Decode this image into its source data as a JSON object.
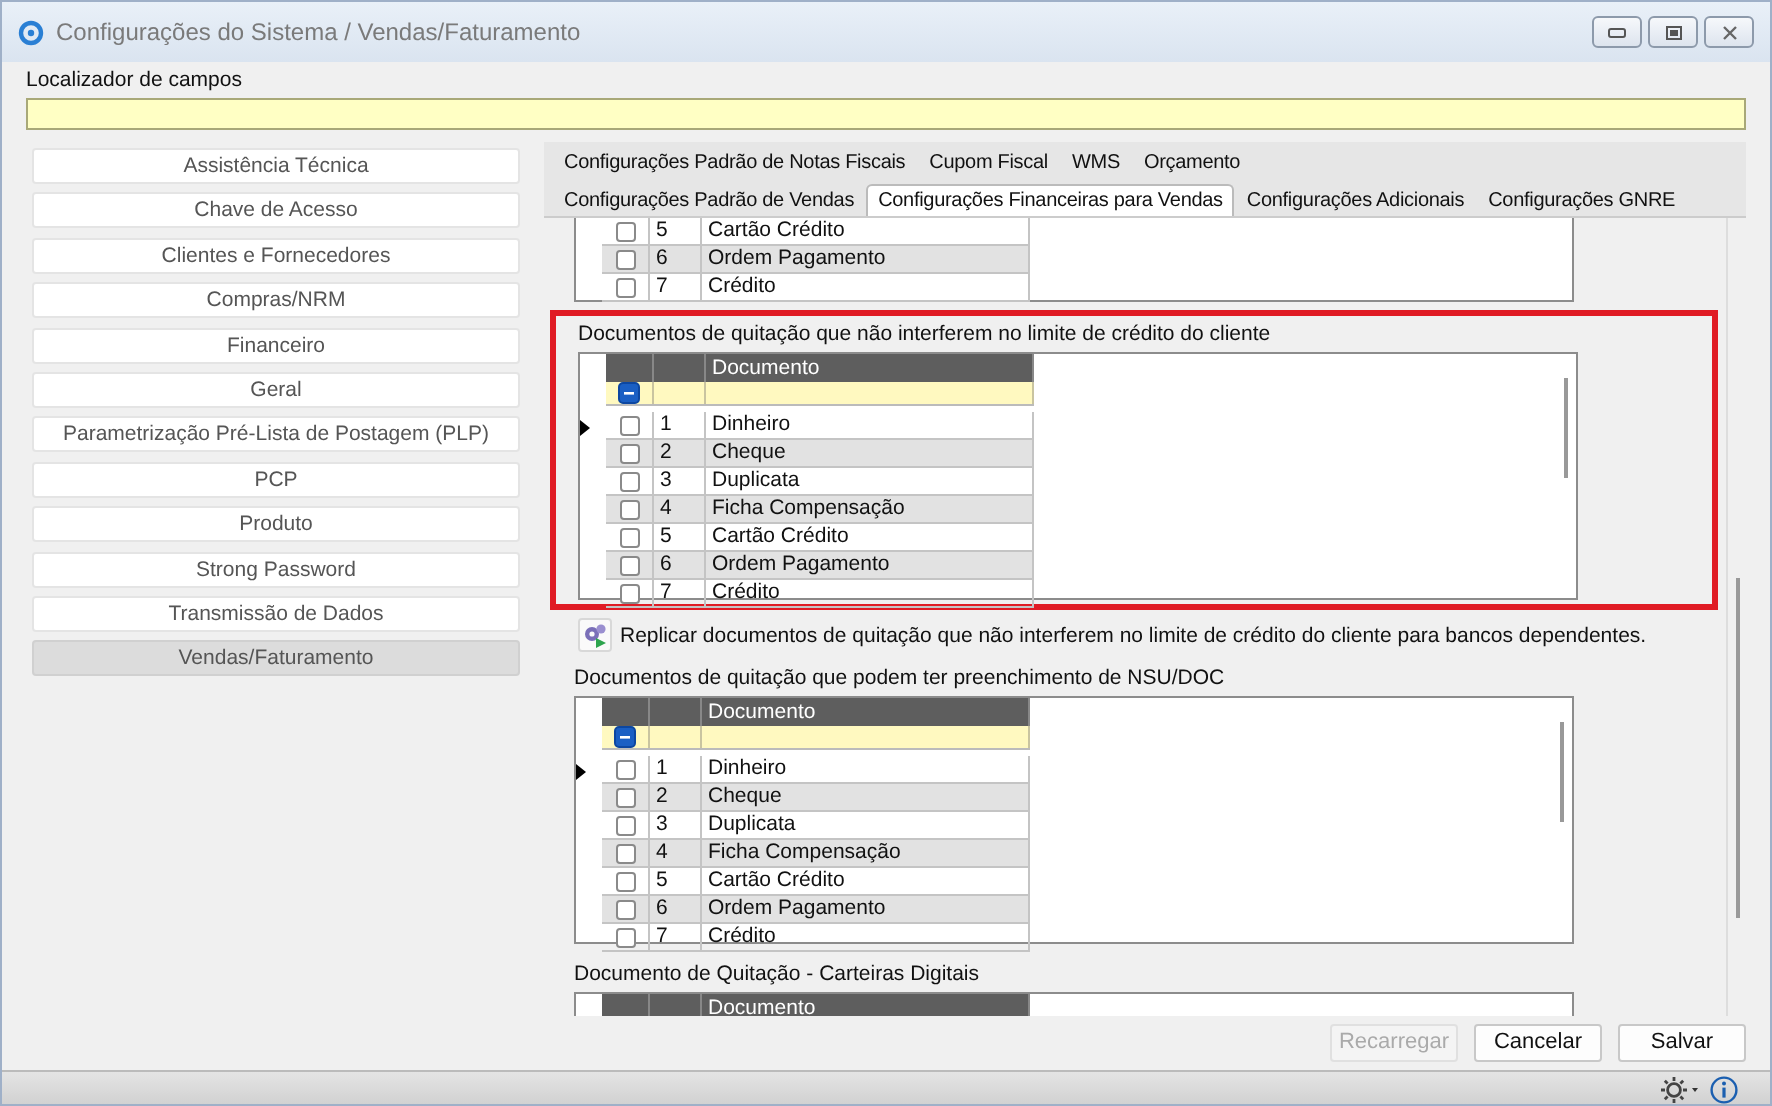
{
  "window": {
    "title": "Configurações do Sistema / Vendas/Faturamento"
  },
  "locator": {
    "label": "Localizador de campos"
  },
  "sidebar": {
    "items": [
      {
        "label": "Assistência Técnica",
        "selected": false
      },
      {
        "label": "Chave de Acesso",
        "selected": false
      },
      {
        "label": "Clientes e Fornecedores",
        "selected": false
      },
      {
        "label": "Compras/NRM",
        "selected": false
      },
      {
        "label": "Financeiro",
        "selected": false
      },
      {
        "label": "Geral",
        "selected": false
      },
      {
        "label": "Parametrização Pré-Lista de Postagem (PLP)",
        "selected": false
      },
      {
        "label": "PCP",
        "selected": false
      },
      {
        "label": "Produto",
        "selected": false
      },
      {
        "label": "Strong Password",
        "selected": false
      },
      {
        "label": "Transmissão de Dados",
        "selected": false
      },
      {
        "label": "Vendas/Faturamento",
        "selected": true
      }
    ]
  },
  "tabs": {
    "upper_row": [
      {
        "label": "Configurações Padrão de Notas Fiscais",
        "selected": false
      },
      {
        "label": "Cupom Fiscal",
        "selected": false
      },
      {
        "label": "WMS",
        "selected": false
      },
      {
        "label": "Orçamento",
        "selected": false
      }
    ],
    "lower_row": [
      {
        "label": "Configurações Padrão de Vendas",
        "selected": false
      },
      {
        "label": "Configurações Financeiras para Vendas",
        "selected": true
      },
      {
        "label": "Configurações Adicionais",
        "selected": false
      },
      {
        "label": "Configurações GNRE",
        "selected": false
      }
    ]
  },
  "content": [
    {
      "kind": "grid",
      "rows": [
        {
          "number": "5",
          "document": "Cartão Crédito",
          "checked": false,
          "current": false
        },
        {
          "number": "6",
          "document": "Ordem Pagamento",
          "checked": false,
          "current": false
        },
        {
          "number": "7",
          "document": "Crédito",
          "checked": false,
          "current": false
        }
      ]
    },
    {
      "kind": "grid",
      "title": "Documentos de quitação que não interferem no limite de crédito do cliente",
      "highlighted": true,
      "columns": [
        "",
        "",
        "Documento"
      ],
      "select_all_indeterminate": true,
      "rows": [
        {
          "number": "1",
          "document": "Dinheiro",
          "checked": false,
          "current": true
        },
        {
          "number": "2",
          "document": "Cheque",
          "checked": false,
          "current": false
        },
        {
          "number": "3",
          "document": "Duplicata",
          "checked": false,
          "current": false
        },
        {
          "number": "4",
          "document": "Ficha Compensação",
          "checked": false,
          "current": false
        },
        {
          "number": "5",
          "document": "Cartão Crédito",
          "checked": false,
          "current": false
        },
        {
          "number": "6",
          "document": "Ordem Pagamento",
          "checked": false,
          "current": false
        },
        {
          "number": "7",
          "document": "Crédito",
          "checked": false,
          "current": false
        }
      ]
    },
    {
      "kind": "action",
      "label": "Replicar documentos de quitação que não interferem no limite de crédito do cliente para bancos dependentes."
    },
    {
      "kind": "grid",
      "title": "Documentos de quitação que podem ter preenchimento de NSU/DOC",
      "highlighted": false,
      "columns": [
        "",
        "",
        "Documento"
      ],
      "select_all_indeterminate": true,
      "rows": [
        {
          "number": "1",
          "document": "Dinheiro",
          "checked": false,
          "current": true
        },
        {
          "number": "2",
          "document": "Cheque",
          "checked": false,
          "current": false
        },
        {
          "number": "3",
          "document": "Duplicata",
          "checked": false,
          "current": false
        },
        {
          "number": "4",
          "document": "Ficha Compensação",
          "checked": false,
          "current": false
        },
        {
          "number": "5",
          "document": "Cartão Crédito",
          "checked": false,
          "current": false
        },
        {
          "number": "6",
          "document": "Ordem Pagamento",
          "checked": false,
          "current": false
        },
        {
          "number": "7",
          "document": "Crédito",
          "checked": false,
          "current": false
        }
      ]
    },
    {
      "kind": "grid",
      "title": "Documento de Quitação - Carteiras Digitais",
      "highlighted": false,
      "columns": [
        "",
        "",
        "Documento"
      ]
    }
  ],
  "footer": {
    "buttons": [
      {
        "label": "Recarregar",
        "disabled": true
      },
      {
        "label": "Cancelar",
        "disabled": false
      },
      {
        "label": "Salvar",
        "disabled": false
      }
    ]
  }
}
